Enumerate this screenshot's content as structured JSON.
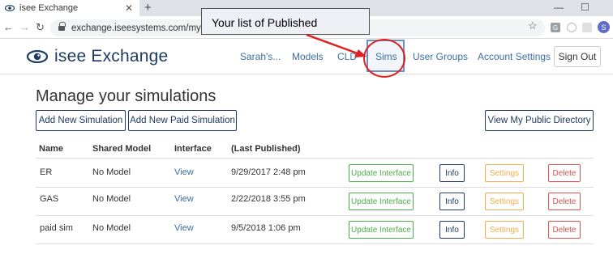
{
  "browser": {
    "tab_title": "isee Exchange",
    "tab_close": "✕",
    "new_tab": "+",
    "min": "—",
    "max": "☐",
    "url": "exchange.iseesystems.com/mysim",
    "profile_initial": "S",
    "ext1_label": "G"
  },
  "header": {
    "brand": "isee Exchange",
    "nav": [
      "Sarah's...",
      "Models",
      "CLD",
      "Sims",
      "User Groups",
      "Account Settings"
    ],
    "sign_out": "Sign Out"
  },
  "annotation": {
    "text": "Your list of Published",
    "color": "#e02020"
  },
  "main": {
    "title": "Manage your simulations",
    "add_new": "Add New Simulation",
    "add_paid": "Add New Paid Simulation",
    "view_public": "View My Public Directory",
    "columns": [
      "Name",
      "Shared Model",
      "Interface",
      "(Last Published)"
    ],
    "rows": [
      {
        "name": "ER",
        "model": "No Model",
        "interface": "View",
        "published": "9/29/2017 2:48 pm"
      },
      {
        "name": "GAS",
        "model": "No Model",
        "interface": "View",
        "published": "2/22/2018 3:55 pm"
      },
      {
        "name": "paid sim",
        "model": "No Model",
        "interface": "View",
        "published": "9/5/2018 1:06 pm"
      }
    ],
    "actions": {
      "update": "Update Interface",
      "info": "Info",
      "settings": "Settings",
      "delete": "Delete"
    }
  },
  "colors": {
    "brand": "#1f3b63",
    "link": "#3a6fa3",
    "update": "#4cae4c",
    "settings": "#f0ad4e",
    "delete": "#d9534f"
  }
}
